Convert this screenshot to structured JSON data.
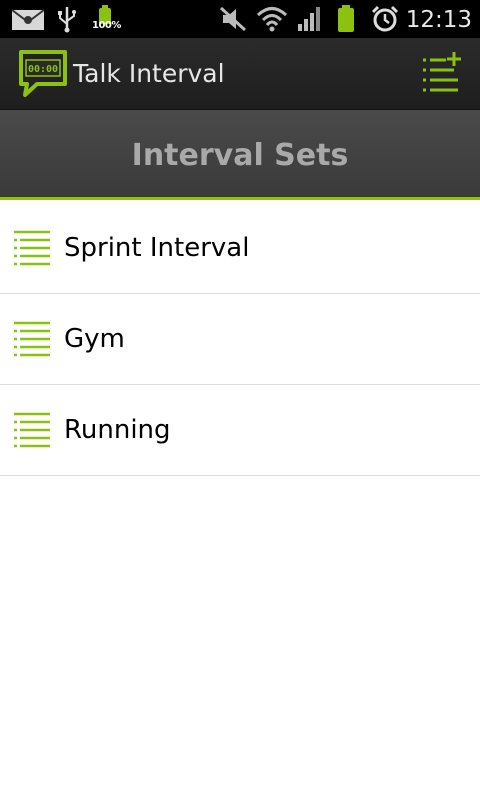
{
  "status_bar": {
    "time": "12:13",
    "battery_percent": "100%",
    "icons": [
      "mail-icon",
      "usb-icon",
      "battery-icon",
      "mute-icon",
      "wifi-icon",
      "signal-icon",
      "battery-icon",
      "alarm-icon"
    ]
  },
  "app": {
    "title": "Talk Interval",
    "accent_color": "#8cc110",
    "logo_icon": "speech-bubble-timer-icon",
    "action_icon": "add-list-icon"
  },
  "section": {
    "title": "Interval Sets"
  },
  "interval_sets": [
    {
      "label": "Sprint Interval",
      "icon": "list-icon"
    },
    {
      "label": "Gym",
      "icon": "list-icon"
    },
    {
      "label": "Running",
      "icon": "list-icon"
    }
  ]
}
